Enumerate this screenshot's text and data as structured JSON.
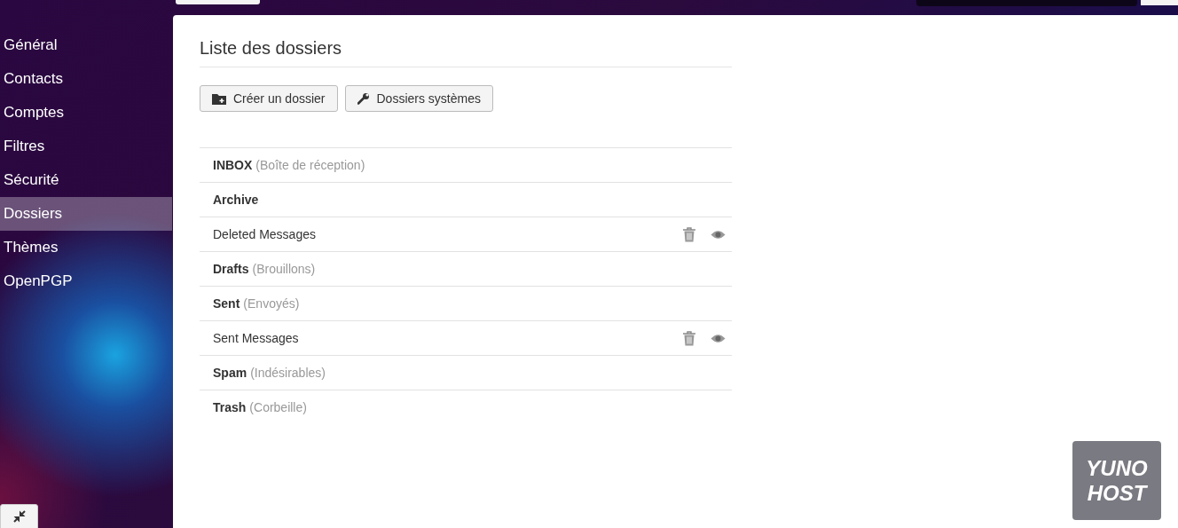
{
  "sidebar": {
    "items": [
      {
        "label": "Général",
        "selected": false
      },
      {
        "label": "Contacts",
        "selected": false
      },
      {
        "label": "Comptes",
        "selected": false
      },
      {
        "label": "Filtres",
        "selected": false
      },
      {
        "label": "Sécurité",
        "selected": false
      },
      {
        "label": "Dossiers",
        "selected": true
      },
      {
        "label": "Thèmes",
        "selected": false
      },
      {
        "label": "OpenPGP",
        "selected": false
      }
    ]
  },
  "panel": {
    "title": "Liste des dossiers",
    "buttons": [
      {
        "kind": "create",
        "label": "Créer un dossier"
      },
      {
        "kind": "system",
        "label": "Dossiers systèmes"
      }
    ],
    "folders": [
      {
        "kind": "system",
        "name": "INBOX",
        "alias": "(Boîte de réception)"
      },
      {
        "kind": "system",
        "name": "Archive"
      },
      {
        "kind": "custom",
        "name": "Deleted Messages"
      },
      {
        "kind": "system",
        "name": "Drafts",
        "alias": "(Brouillons)"
      },
      {
        "kind": "system",
        "name": "Sent",
        "alias": "(Envoyés)"
      },
      {
        "kind": "custom",
        "name": "Sent Messages"
      },
      {
        "kind": "system",
        "name": "Spam",
        "alias": "(Indésirables)"
      },
      {
        "kind": "system",
        "name": "Trash",
        "alias": "(Corbeille)"
      }
    ]
  },
  "logo": {
    "lines": [
      "YUNO",
      "HOST"
    ]
  }
}
